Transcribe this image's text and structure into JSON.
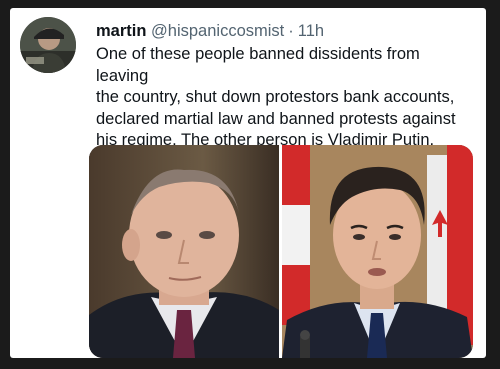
{
  "tweet": {
    "display_name": "martin",
    "handle": "@hispaniccosmist",
    "separator": "·",
    "time": "11h",
    "text": "One of these people banned dissidents from leaving\nthe country, shut down protestors bank accounts,\ndeclared martial law and banned protests against\nhis regime.  The other person is Vladimir Putin."
  },
  "media": {
    "left_photo": "photo-of-man-in-dark-suit-and-tie",
    "right_photo": "photo-of-man-in-suit-with-red-and-white-flag"
  },
  "colors": {
    "background": "#1b1b1b",
    "card": "#ffffff",
    "name": "#0f1419",
    "meta": "#536471"
  }
}
